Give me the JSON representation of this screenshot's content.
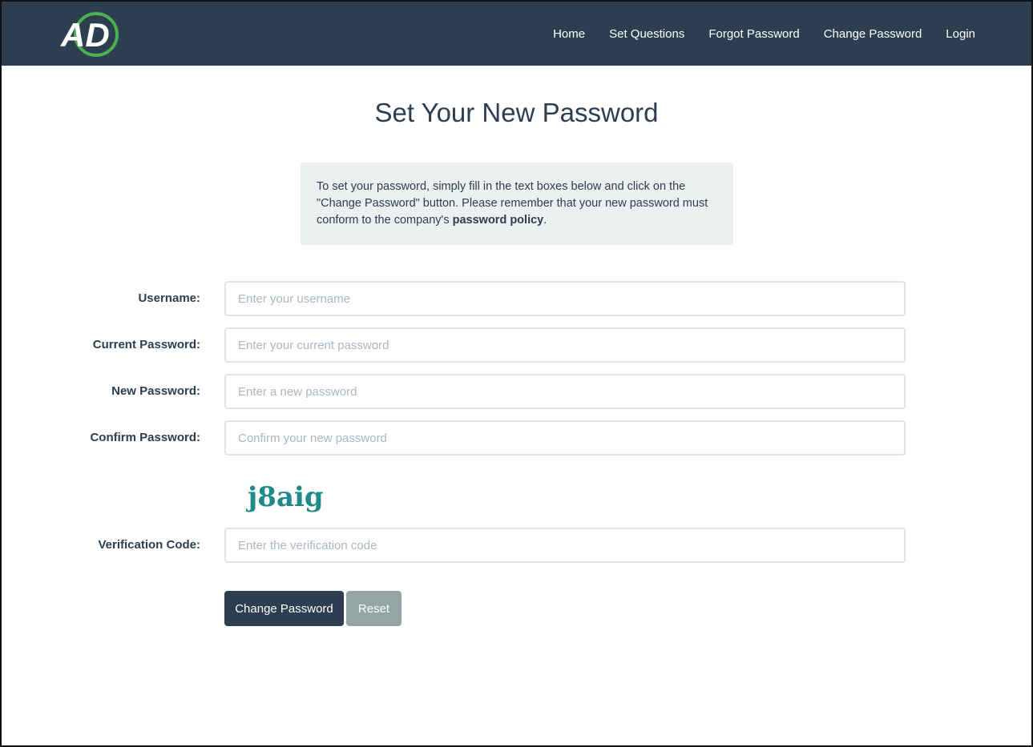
{
  "nav": {
    "logo_text": "AD",
    "links": [
      "Home",
      "Set Questions",
      "Forgot Password",
      "Change Password",
      "Login"
    ]
  },
  "page": {
    "title": "Set Your New Password"
  },
  "info": {
    "text_before": "To set your password, simply fill in the text boxes below and click on the \"Change Password\" button. Please remember that your new password must conform to the company's ",
    "bold": "password policy",
    "text_after": "."
  },
  "form": {
    "username": {
      "label": "Username:",
      "placeholder": "Enter your username"
    },
    "current_password": {
      "label": "Current Password:",
      "placeholder": "Enter your current password"
    },
    "new_password": {
      "label": "New Password:",
      "placeholder": "Enter a new password"
    },
    "confirm_password": {
      "label": "Confirm Password:",
      "placeholder": "Confirm your new password"
    },
    "captcha_text": "j8aig",
    "verification": {
      "label": "Verification Code:",
      "placeholder": "Enter the verification code"
    }
  },
  "buttons": {
    "submit": "Change Password",
    "reset": "Reset"
  },
  "colors": {
    "navbar": "#2c3e50",
    "logo_green": "#4caf50",
    "captcha": "#1f8a8a",
    "reset_button": "#95a5a6"
  }
}
